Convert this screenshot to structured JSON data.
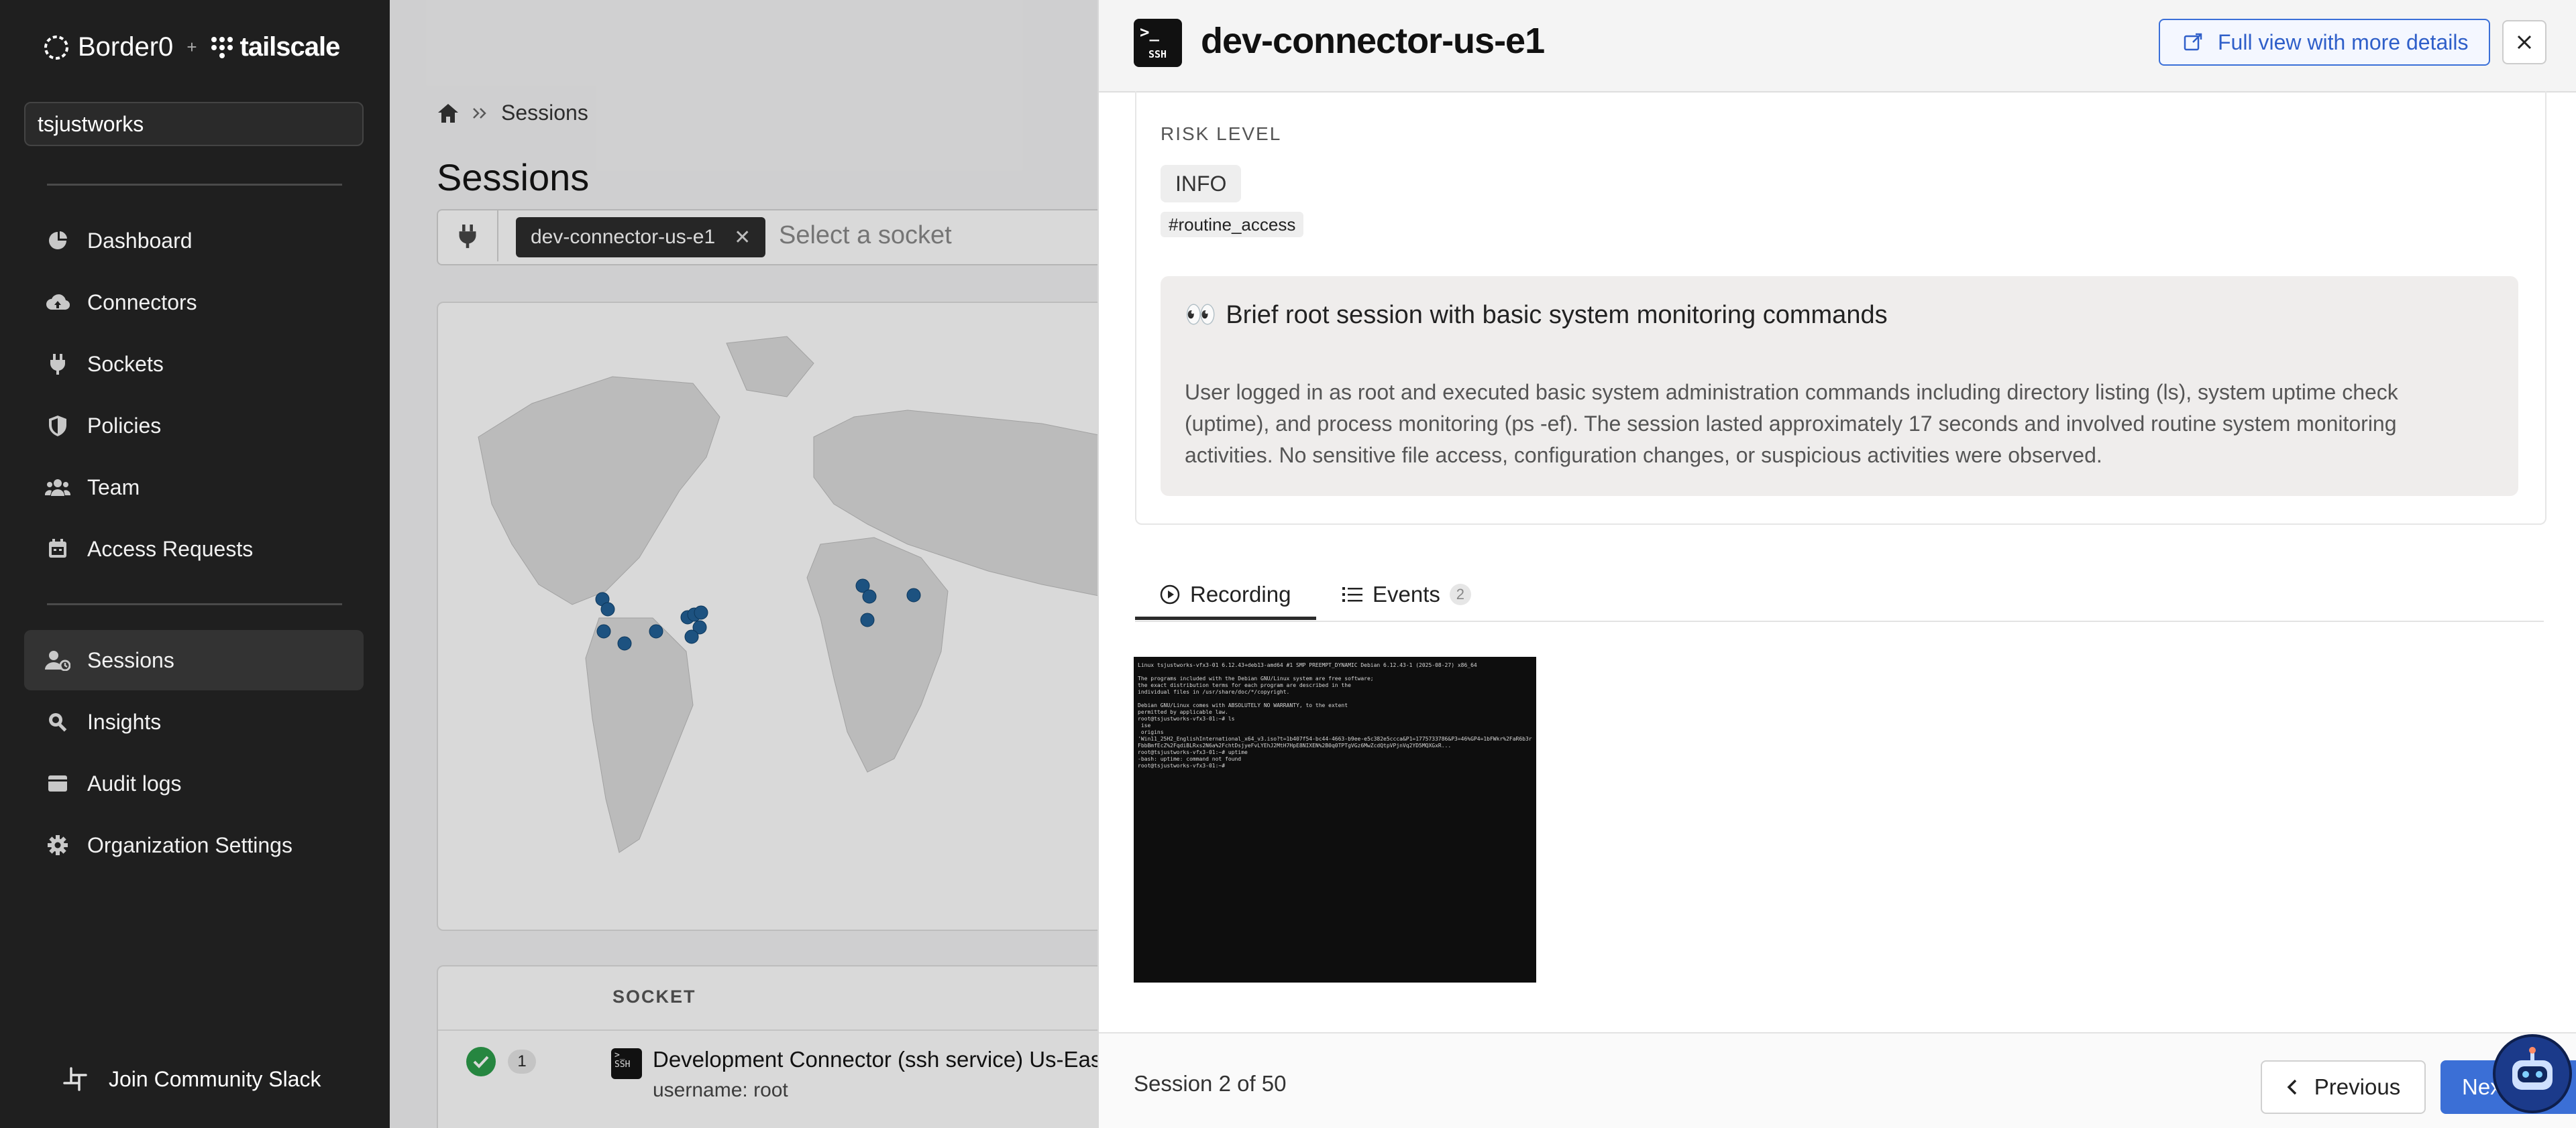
{
  "sidebar": {
    "logo": {
      "brand": "Border0",
      "partner": "tailscale"
    },
    "org_name": "tsjustworks",
    "items": [
      {
        "label": "Dashboard",
        "icon": "dashboard-icon"
      },
      {
        "label": "Connectors",
        "icon": "cloud-upload-icon"
      },
      {
        "label": "Sockets",
        "icon": "plug-icon"
      },
      {
        "label": "Policies",
        "icon": "shield-icon"
      },
      {
        "label": "Team",
        "icon": "team-icon"
      },
      {
        "label": "Access Requests",
        "icon": "calendar-icon"
      },
      {
        "label": "Sessions",
        "icon": "user-session-icon",
        "active": true
      },
      {
        "label": "Insights",
        "icon": "search-icon"
      },
      {
        "label": "Audit logs",
        "icon": "audit-icon"
      },
      {
        "label": "Organization Settings",
        "icon": "gear-icon"
      }
    ],
    "slack_label": "Join Community Slack"
  },
  "main": {
    "breadcrumb": "Sessions",
    "title": "Sessions",
    "filter_chip": "dev-connector-us-e1",
    "filter_placeholder": "Select a socket",
    "table": {
      "column_socket": "SOCKET",
      "row": {
        "count": "1",
        "title": "Development Connector (ssh service) Us-East",
        "subtitle": "username: root"
      }
    }
  },
  "drawer": {
    "title": "dev-connector-us-e1",
    "ssh_badge": "SSH",
    "full_view_label": "Full view with more details",
    "risk_label": "RISK LEVEL",
    "risk_value": "INFO",
    "tag": "#routine_access",
    "summary_emoji": "👀",
    "summary_title": "Brief root session with basic system monitoring commands",
    "summary_text": "User logged in as root and executed basic system administration commands including directory listing (ls), system uptime check (uptime), and process monitoring (ps -ef). The session lasted approximately 17 seconds and involved routine system monitoring activities. No sensitive file access, configuration changes, or suspicious activities were observed.",
    "tab_recording": "Recording",
    "tab_events": "Events",
    "events_count": "2",
    "terminal_text": "Linux tsjustworks-vfx3-01 6.12.43+deb13-amd64 #1 SMP PREEMPT_DYNAMIC Debian 6.12.43-1 (2025-08-27) x86_64\n\nThe programs included with the Debian GNU/Linux system are free software;\nthe exact distribution terms for each program are described in the\nindividual files in /usr/share/doc/*/copyright.\n\nDebian GNU/Linux comes with ABSOLUTELY NO WARRANTY, to the extent\npermitted by applicable law.\nroot@tsjustworks-vfx3-01:~# ls\n ise\n origins\n'Win11_25H2_EnglishInternational_x64_v3.iso?t=1b407f54-bc44-4663-b9ee-e5c382e5ccca&P1=1775733786&P3=46%GP4=1bFWkr%2FaR6b3rFbbBmfEcZ%2FqdiBLRxs2N6a%2FchtDsjyeFvLYEhJ2MtH7HpE8NIXEN%2B0q0TPTgVGz6MwZcdQtpVPjnVq2YD5MQXGxR...\nroot@tsjustworks-vfx3-01:~# uptime\n-bash: uptime: command not found\nroot@tsjustworks-vfx3-01:~# ",
    "session_counter": "Session 2 of 50",
    "prev_label": "Previous",
    "next_label": "Next"
  },
  "colors": {
    "sidebar_bg": "#1f1f1f",
    "accent_blue": "#3b6fd6",
    "map_dot": "#1f5f95",
    "success": "#2a9d49"
  }
}
